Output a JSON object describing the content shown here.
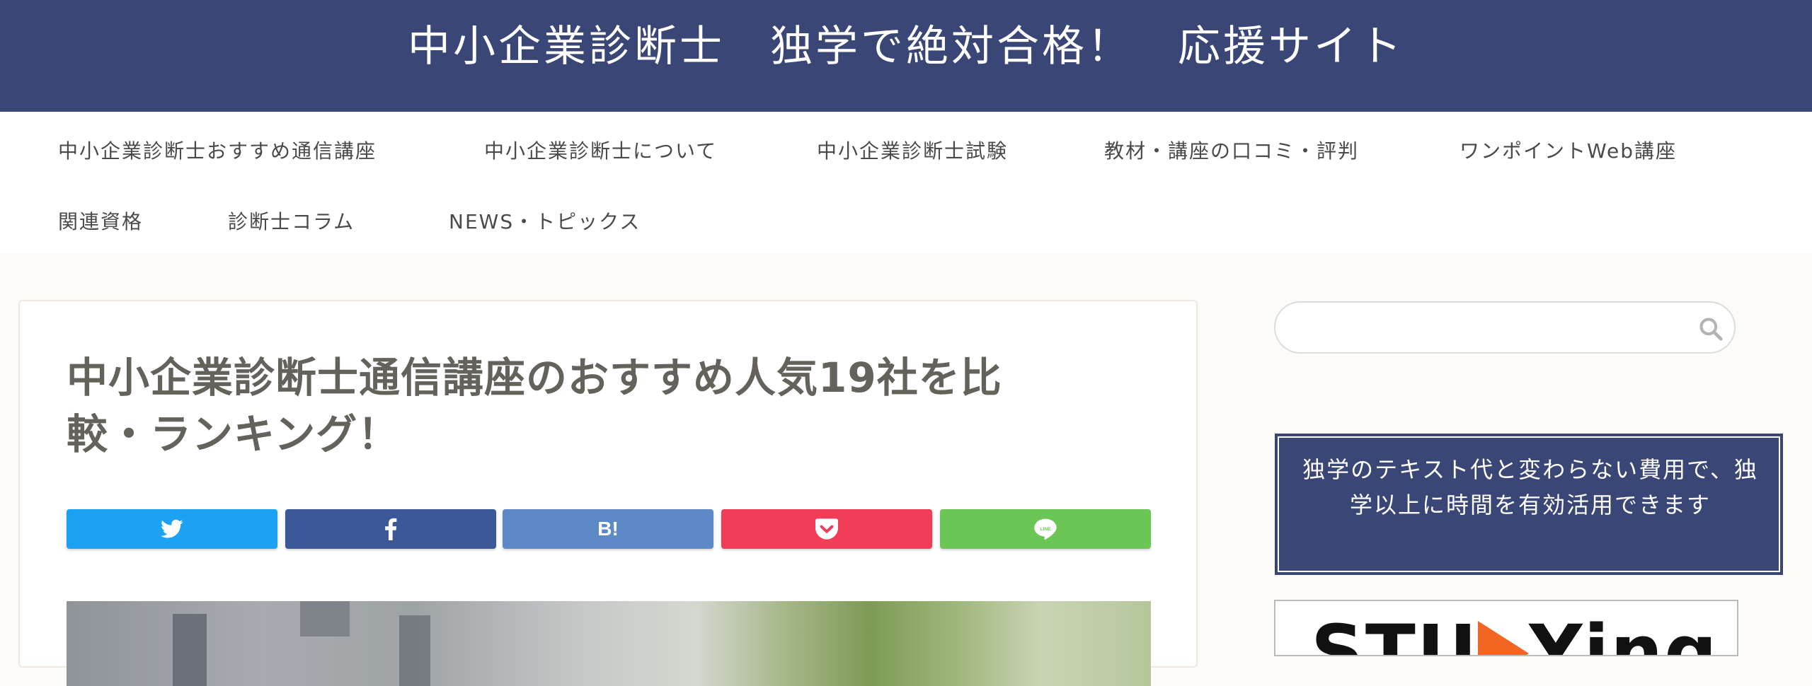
{
  "header": {
    "title": "中小企業診断士　独学で絶対合格！　応援サイト"
  },
  "nav": {
    "items": [
      "中小企業診断士おすすめ通信講座",
      "中小企業診断士について",
      "中小企業診断士試験",
      "教材・講座の口コミ・評判",
      "ワンポイントWeb講座",
      "関連資格",
      "診断士コラム",
      "NEWS・トピックス"
    ]
  },
  "article": {
    "title_line1": "中小企業診断士通信講座のおすすめ人気19社を比",
    "title_line2": "較・ランキング！",
    "share": {
      "hatena_label": "B!"
    }
  },
  "sidebar": {
    "search": {
      "placeholder": "",
      "value": ""
    },
    "promo_text": "独学のテキスト代と変わらない費用で、独学以上に時間を有効活用できます",
    "banner_brand_left": "STU",
    "banner_brand_right": "Ying"
  },
  "colors": {
    "header_bg": "#3a4675",
    "twitter": "#1da1f2",
    "facebook": "#3b5998",
    "hatena": "#5d8ac7",
    "pocket": "#ef3e56",
    "line": "#6cc655",
    "page_bg": "#fcfbf7"
  },
  "icons": [
    "twitter-icon",
    "facebook-icon",
    "hatena-bookmark-icon",
    "pocket-icon",
    "line-icon",
    "search-icon",
    "play-icon"
  ]
}
